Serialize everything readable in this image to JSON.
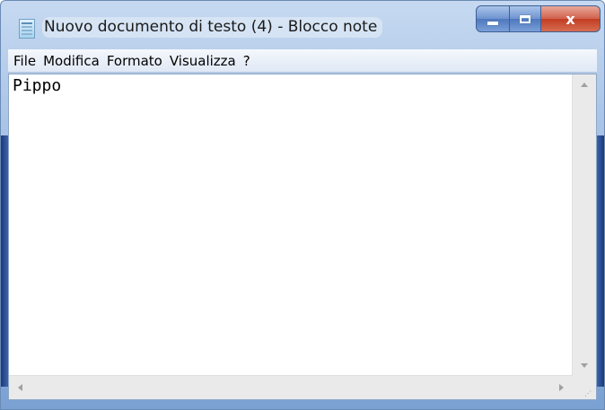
{
  "window": {
    "title": "Nuovo documento di testo (4) - Blocco note",
    "icon": "notepad-icon",
    "buttons": {
      "minimize_icon": "minimize-icon",
      "maximize_icon": "maximize-icon",
      "close_label": "x"
    }
  },
  "menubar": {
    "items": [
      {
        "label": "File"
      },
      {
        "label": "Modifica"
      },
      {
        "label": "Formato"
      },
      {
        "label": "Visualizza"
      },
      {
        "label": "?"
      }
    ]
  },
  "editor": {
    "content": "Pippo"
  },
  "colors": {
    "titlebar_accent": "#7aa1d2",
    "close_button": "#c23c23",
    "editor_background": "#ffffff"
  }
}
